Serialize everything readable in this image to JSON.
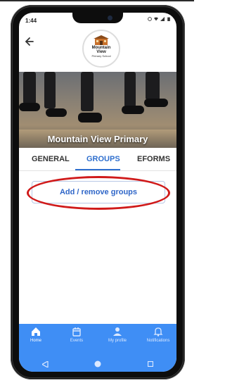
{
  "status": {
    "time": "1:44"
  },
  "school": {
    "logo_line1": "Mountain",
    "logo_line2": "View",
    "logo_line3": "Primary School",
    "banner_title": "Mountain View Primary"
  },
  "tabs": [
    {
      "label": "GENERAL"
    },
    {
      "label": "GROUPS",
      "active": true
    },
    {
      "label": "EFORMS"
    }
  ],
  "groups": {
    "button_label": "Add / remove groups"
  },
  "bottom_nav": [
    {
      "label": "Home",
      "icon": "home-icon"
    },
    {
      "label": "Events",
      "icon": "calendar-icon"
    },
    {
      "label": "My profile",
      "icon": "person-icon"
    },
    {
      "label": "Notifications",
      "icon": "bell-icon"
    }
  ],
  "colors": {
    "accent": "#2f6fce",
    "nav_bg": "#3f8ef5",
    "highlight": "#d01a1a"
  }
}
